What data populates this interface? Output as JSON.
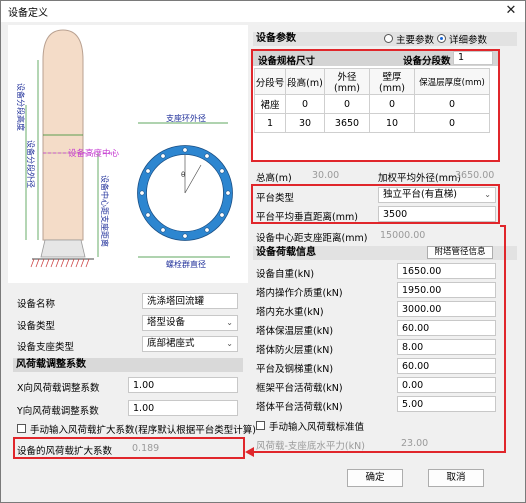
{
  "window": {
    "title": "设备定义",
    "close_glyph": "✕"
  },
  "drawing": {
    "labels": {
      "segment_outer_dia": "设备分段外径",
      "segment_height": "设备分段高度",
      "height_to_center": "设备高度中心",
      "center_to_support": "设备中心距支座距离",
      "ring_outer_dia": "支座环外径",
      "bolt_circle_dia": "螺栓群直径"
    }
  },
  "params": {
    "header": "设备参数",
    "mode_main": "主要参数",
    "mode_detail": "详细参数",
    "dims_header": "设备规格尺寸",
    "segments_label": "设备分段数",
    "segments_value": "1",
    "columns": [
      "分段号",
      "段高(m)",
      "外径(mm)",
      "壁厚(mm)",
      "保温层厚度(mm)"
    ],
    "rows": [
      [
        "裙座",
        "0",
        "0",
        "0",
        "0"
      ],
      [
        "1",
        "30",
        "3650",
        "10",
        "0"
      ]
    ],
    "total_height_label": "总高(m)",
    "total_height_value": "30.00",
    "weighted_dia_label": "加权平均外径(mm)",
    "weighted_dia_value": "3650.00",
    "platform_type_label": "平台类型",
    "platform_type_value": "独立平台(有直梯)",
    "platform_avg_label": "平台平均垂直距离(mm)",
    "platform_avg_value": "3500",
    "center_support_label": "设备中心距支座距离(mm)",
    "center_support_value": "15000.00"
  },
  "loads": {
    "header": "设备荷载信息",
    "pipe_btn": "附塔管径信息",
    "items": [
      {
        "label": "设备自重(kN)",
        "value": "1650.00"
      },
      {
        "label": "塔内操作介质重(kN)",
        "value": "1950.00"
      },
      {
        "label": "塔内充水重(kN)",
        "value": "3000.00"
      },
      {
        "label": "塔体保温层重(kN)",
        "value": "60.00"
      },
      {
        "label": "塔体防火层重(kN)",
        "value": "8.00"
      },
      {
        "label": "平台及钢梯重(kN)",
        "value": "60.00"
      },
      {
        "label": "框架平台活荷载(kN)",
        "value": "0.00"
      },
      {
        "label": "塔体平台活荷载(kN)",
        "value": "5.00"
      }
    ],
    "wind_std_check": "手动输入风荷载标准值",
    "wind_std_label": "风荷载-支座底水平力(kN)",
    "wind_std_value": "23.00"
  },
  "left": {
    "name_label": "设备名称",
    "name_value": "洗涤塔回流罐",
    "type_label": "设备类型",
    "type_value": "塔型设备",
    "support_label": "设备支座类型",
    "support_value": "底部裙座式",
    "wind_section": "风荷载调整系数",
    "x_label": "X向风荷载调整系数",
    "x_value": "1.00",
    "y_label": "Y向风荷载调整系数",
    "y_value": "1.00",
    "manual_check": "手动输入风荷载扩大系数(程序默认根据平台类型计算)",
    "amp_label": "设备的风荷载扩大系数",
    "amp_value": "0.189"
  },
  "buttons": {
    "ok": "确定",
    "cancel": "取消"
  },
  "colors": {
    "highlight": "#e0262b",
    "tower": "#f4dcc8",
    "ring": "#2d86d0"
  }
}
